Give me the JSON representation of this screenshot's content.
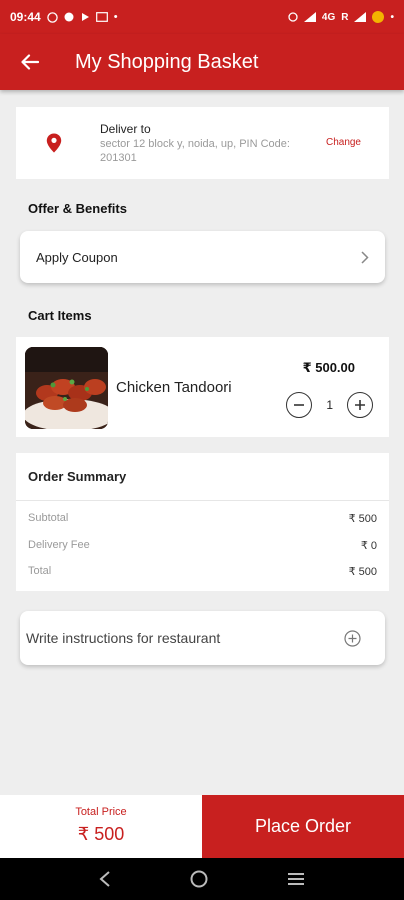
{
  "status_bar": {
    "time": "09:44",
    "network": "4G",
    "carrier": "R"
  },
  "header": {
    "title": "My Shopping Basket"
  },
  "delivery": {
    "label": "Deliver to",
    "address": "sector 12 block y, noida, up, PIN Code: 201301",
    "change_label": "Change"
  },
  "offers": {
    "section_title": "Offer & Benefits",
    "coupon_label": "Apply Coupon"
  },
  "cart": {
    "section_title": "Cart Items",
    "items": [
      {
        "name": "Chicken Tandoori",
        "price": "₹ 500.00",
        "quantity": "1"
      }
    ]
  },
  "summary": {
    "title": "Order Summary",
    "rows": [
      {
        "label": "Subtotal",
        "value": "₹ 500"
      },
      {
        "label": "Delivery Fee",
        "value": "₹ 0"
      },
      {
        "label": "Total",
        "value": "₹ 500"
      }
    ]
  },
  "instructions": {
    "placeholder": "Write instructions for restaurant"
  },
  "footer": {
    "total_label": "Total Price",
    "total_value": "₹ 500",
    "place_order_label": "Place Order"
  },
  "colors": {
    "primary": "#c8201f",
    "background": "#eeeeee"
  }
}
